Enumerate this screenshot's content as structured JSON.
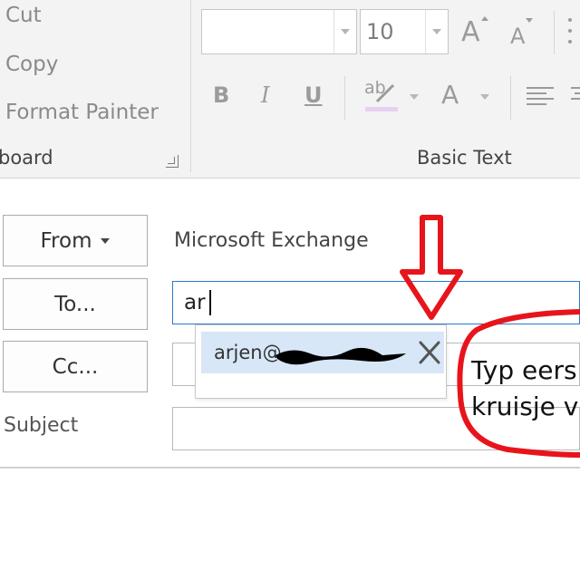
{
  "ribbon": {
    "clipboard": {
      "cut": "Cut",
      "copy": "Copy",
      "format_painter": "Format Painter",
      "group_label": "board"
    },
    "basic_text": {
      "font_name": "",
      "font_size": "10",
      "grow_font": "A",
      "shrink_font": "A",
      "bold": "B",
      "italic": "I",
      "underline": "U",
      "highlight": "ab",
      "font_color": "A",
      "group_label": "Basic Text"
    }
  },
  "header": {
    "from_button": "From",
    "from_value": "Microsoft Exchange",
    "to_button": "To...",
    "to_value": "ar",
    "cc_button": "Cc...",
    "cc_value": "",
    "subject_label": "Subject",
    "subject_value": ""
  },
  "autocomplete": {
    "suggestion": "arjen@"
  },
  "annotation": {
    "text_line1": "Typ eers",
    "text_line2": "kruisje v"
  },
  "colors": {
    "accent": "#2b79c9",
    "suggestion_bg": "#d7e7f7",
    "annotation_red": "#e8141b"
  }
}
